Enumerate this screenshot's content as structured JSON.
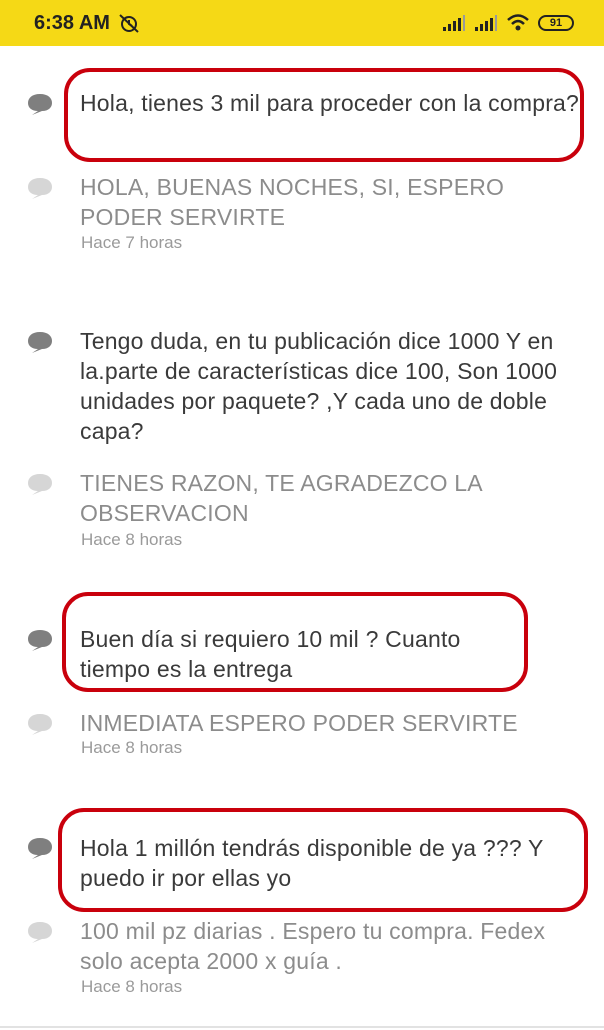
{
  "status_bar": {
    "time": "6:38 AM",
    "battery": "91",
    "icons": [
      "alarm-off-icon",
      "signal-icon",
      "signal-icon",
      "wifi-icon",
      "battery-icon"
    ]
  },
  "colors": {
    "status_bar_bg": "#f5d916",
    "highlight": "#c9000c",
    "question_icon": "#7f7f7f",
    "answer_icon": "#d6d6d6"
  },
  "conversations": [
    {
      "question": "Hola, tienes 3 mil para proceder con la compra?",
      "answer": "HOLA, BUENAS NOCHES, SI, ESPERO PODER SERVIRTE",
      "time": "Hace 7 horas",
      "highlighted": true
    },
    {
      "question": "Tengo duda, en tu publicación dice 1000 Y en la.parte de características dice 100, Son 1000 unidades por paquete? ,Y cada uno de doble capa?",
      "answer": "TIENES RAZON, TE AGRADEZCO LA OBSERVACION",
      "time": "Hace 8 horas",
      "highlighted": false
    },
    {
      "question": "Buen día si requiero 10 mil ? Cuanto tiempo es la entrega",
      "answer": "INMEDIATA ESPERO PODER SERVIRTE",
      "time": "Hace 8 horas",
      "highlighted": true
    },
    {
      "question": "Hola 1 millón tendrás disponible de ya ??? Y puedo ir por ellas yo",
      "answer": "100 mil pz diarias . Espero tu compra. Fedex solo acepta 2000 x guía .",
      "time": "Hace 8 horas",
      "highlighted": true
    }
  ]
}
